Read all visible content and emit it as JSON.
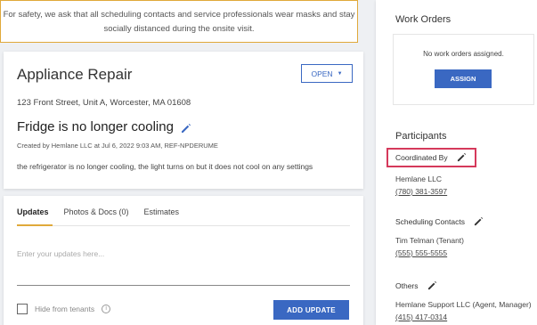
{
  "notice": {
    "line1": "For safety, we ask that all scheduling contacts and service professionals wear masks and stay",
    "line2": "socially distanced during the onsite visit."
  },
  "repair": {
    "title": "Appliance Repair",
    "status_label": "OPEN",
    "address": "123 Front Street, Unit A, Worcester, MA 01608",
    "issue_title": "Fridge is no longer cooling",
    "created": "Created by Hemlane LLC at Jul 6, 2022 9:03 AM, REF-NPDERUME",
    "description": "the refrigerator is no longer cooling, the light turns on but it does not cool on any settings"
  },
  "updates": {
    "tabs": [
      {
        "label": "Updates"
      },
      {
        "label": "Photos & Docs (0)"
      },
      {
        "label": "Estimates"
      }
    ],
    "placeholder": "Enter your updates here...",
    "hide_label": "Hide from tenants",
    "add_button": "ADD UPDATE"
  },
  "work_orders": {
    "title": "Work Orders",
    "empty_message": "No work orders assigned.",
    "assign_button": "ASSIGN"
  },
  "participants": {
    "title": "Participants",
    "coordinated_by_label": "Coordinated By",
    "coordinator_name": "Hemlane LLC",
    "coordinator_phone": "(780) 381-3597",
    "scheduling_label": "Scheduling Contacts",
    "scheduling_name": "Tim Telman (Tenant)",
    "scheduling_phone": "(555) 555-5555",
    "others_label": "Others",
    "others_name": "Hemlane Support LLC (Agent, Manager)",
    "others_phone": "(415) 417-0314"
  },
  "colors": {
    "accent_blue": "#3a68c2",
    "notice_border": "#e0a93a",
    "highlight_red": "#d5395b"
  }
}
